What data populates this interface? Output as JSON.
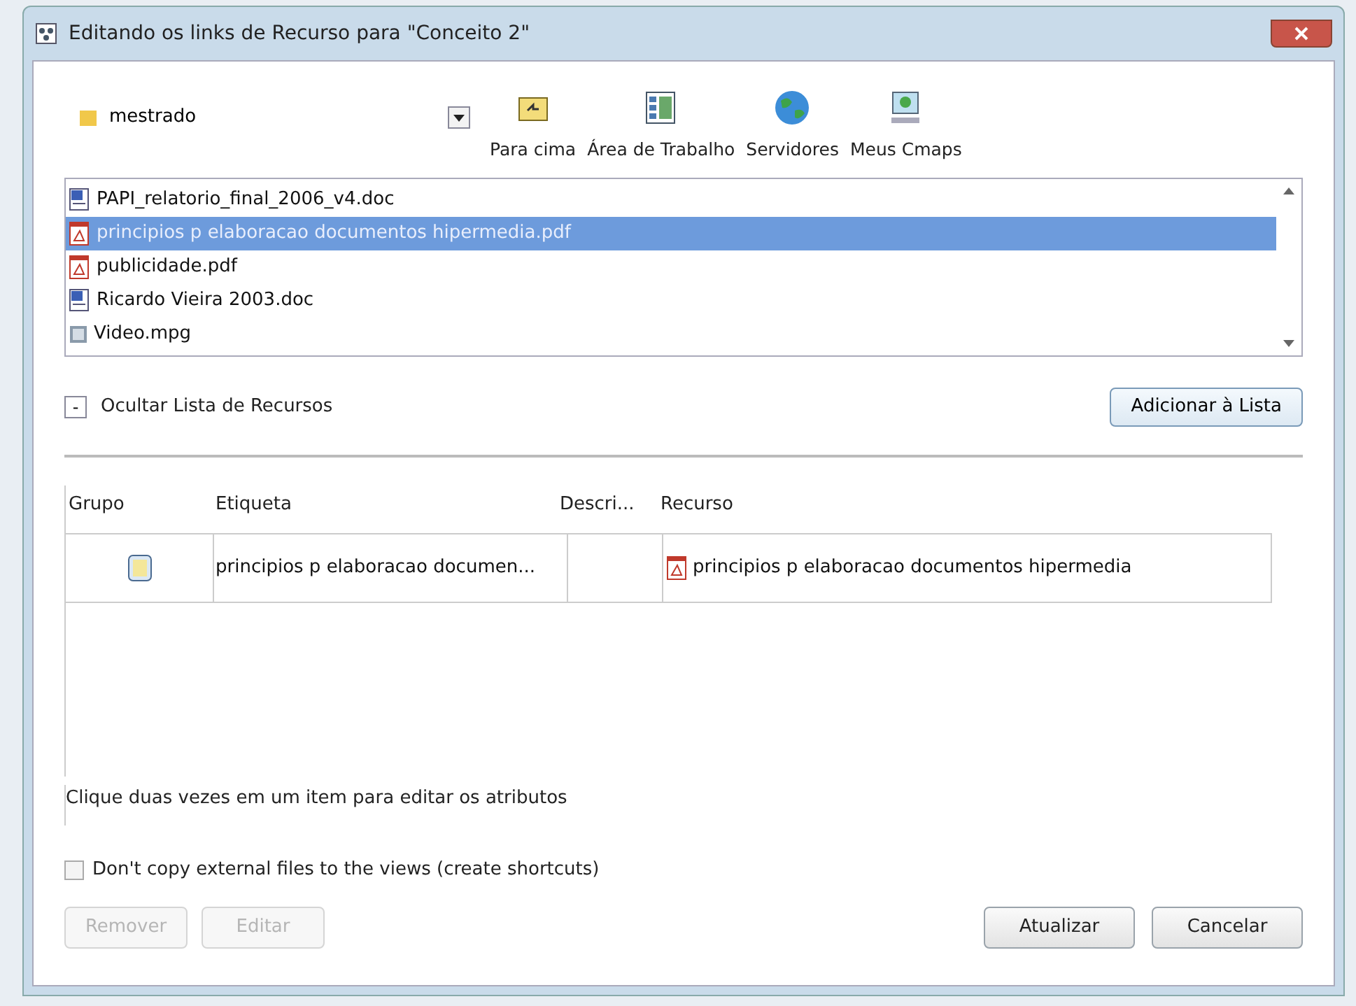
{
  "window": {
    "title": "Editando os links de Recurso para \"Conceito 2\""
  },
  "folder": {
    "value": "mestrado"
  },
  "toolbar": [
    {
      "kind": "up",
      "label": "Para cima"
    },
    {
      "kind": "desktop",
      "label": "Área de Trabalho"
    },
    {
      "kind": "servers",
      "label": "Servidores"
    },
    {
      "kind": "cmaps",
      "label": "Meus Cmaps"
    }
  ],
  "files": [
    {
      "kind": "doc",
      "name": "PAPI_relatorio_final_2006_v4.doc",
      "selected": false
    },
    {
      "kind": "pdf",
      "name": "principios p elaboracao documentos hipermedia.pdf",
      "selected": true
    },
    {
      "kind": "pdf",
      "name": "publicidade.pdf",
      "selected": false
    },
    {
      "kind": "doc",
      "name": "Ricardo Vieira 2003.doc",
      "selected": false
    },
    {
      "kind": "video",
      "name": "Video.mpg",
      "selected": false
    }
  ],
  "toggle": {
    "symbol": "-",
    "label": "Ocultar Lista de Recursos"
  },
  "add_button": "Adicionar à Lista",
  "table": {
    "columns": [
      "Grupo",
      "Etiqueta",
      "Descri...",
      "Recurso"
    ],
    "rows": [
      {
        "label": "principios p elaboracao documen...",
        "description": "",
        "resource": "principios p elaboracao documentos hipermedia"
      }
    ]
  },
  "hint": "Clique duas vezes em um item para editar os atributos",
  "shortcut_checkbox": {
    "label": "Don't copy external files to the views (create shortcuts)",
    "checked": false
  },
  "buttons_left": [
    {
      "label": "Remover",
      "disabled": true
    },
    {
      "label": "Editar",
      "disabled": true
    }
  ],
  "buttons_right": [
    {
      "label": "Atualizar",
      "disabled": false
    },
    {
      "label": "Cancelar",
      "disabled": false
    }
  ]
}
